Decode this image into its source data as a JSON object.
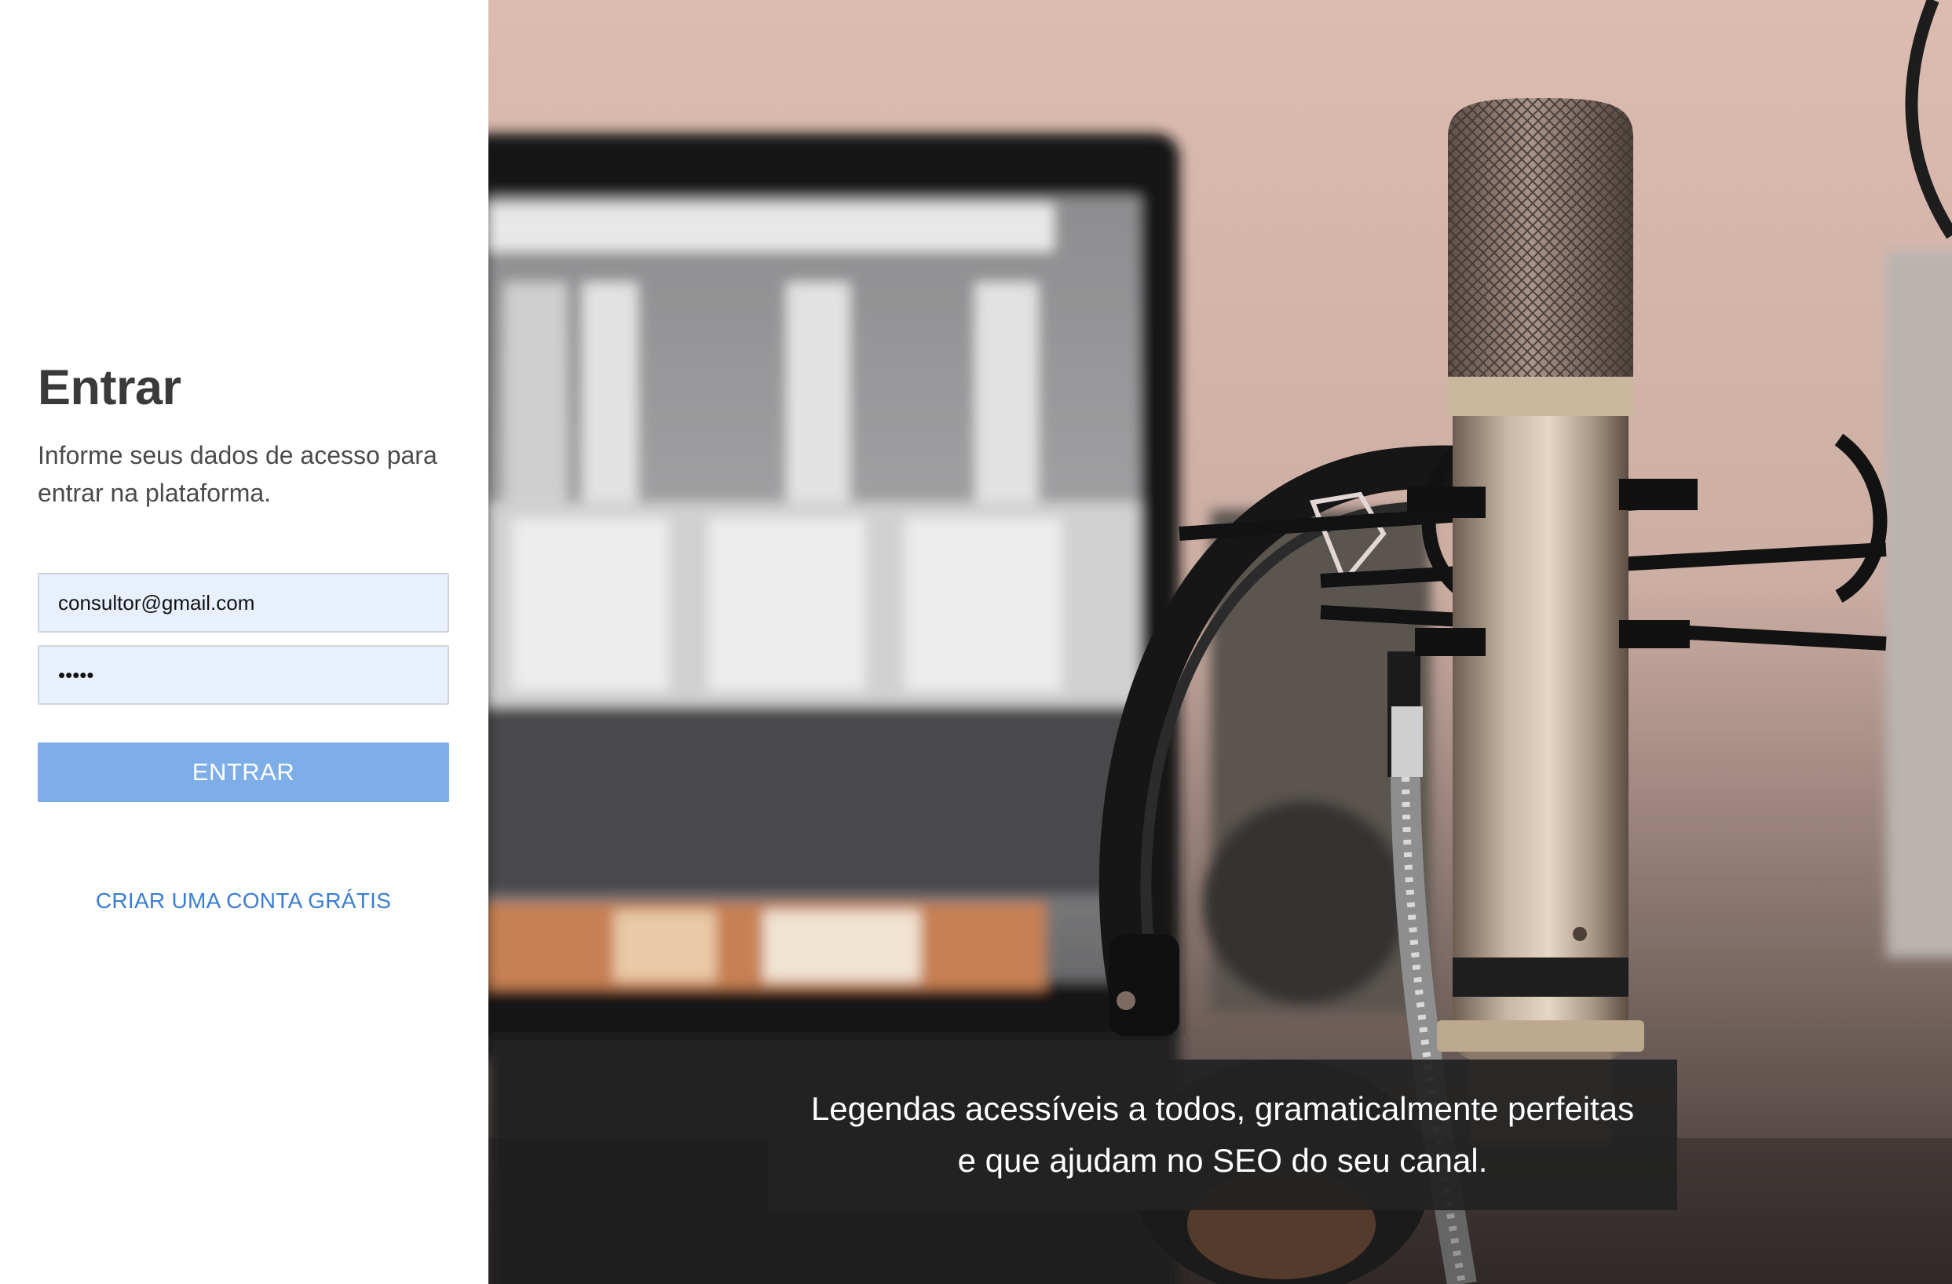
{
  "login": {
    "title": "Entrar",
    "subtitle": "Informe seus dados de acesso para entrar na plataforma.",
    "email_value": "consultor@gmail.com",
    "password_value": "•••••",
    "submit_label": "ENTRAR",
    "signup_label": "CRIAR UMA CONTA GRÁTIS"
  },
  "hero": {
    "image_alt": "Microfone de estúdio com fones de ouvido e monitor ao fundo",
    "caption_line1": "Legendas acessíveis a todos, gramaticalmente perfeitas",
    "caption_line2": "e que ajudam no SEO do seu canal."
  },
  "colors": {
    "button_bg": "#7eaee8",
    "link": "#3b7dd0",
    "input_bg": "#e8f0fe",
    "title": "#3a3a3a",
    "caption_bg": "#222222"
  }
}
